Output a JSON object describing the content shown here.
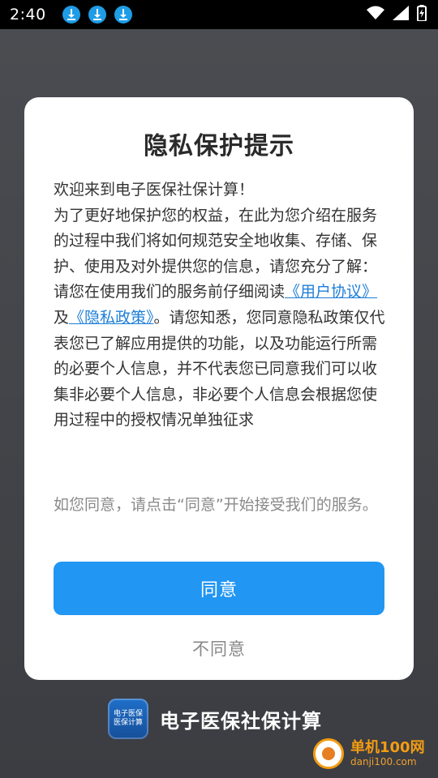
{
  "status_bar": {
    "time": "2:40",
    "download_icons": [
      "download-icon",
      "download-icon",
      "download-icon"
    ],
    "icons": [
      "wifi-icon",
      "signal-icon",
      "battery-icon"
    ]
  },
  "dialog": {
    "title": "隐私保护提示",
    "paragraph1": "欢迎来到电子医保社保计算！",
    "paragraph2": "为了更好地保护您的权益，在此为您介绍在服务的过程中我们将如何规范安全地收集、存储、保护、使用及对外提供您的信息，请您充分了解：",
    "paragraph3_prefix": "请您在使用我们的服务前仔细阅读",
    "link_user_agreement": "《用户协议》",
    "and": "及",
    "link_privacy_policy": "《隐私政策》",
    "paragraph3_suffix": "。请您知悉，您同意隐私政策仅代表您已了解应用提供的功能，以及功能运行所需的必要个人信息，并不代表您已同意我们可以收集非必要个人信息，非必要个人信息会根据您使用过程中的授权情况单独征求",
    "note": "如您同意，请点击“同意”开始接受我们的服务。",
    "agree_label": "同意",
    "disagree_label": "不同意"
  },
  "app": {
    "name": "电子医保社保计算",
    "icon_text_top": "电子医保",
    "icon_text_bottom": "医保计算"
  },
  "watermark": {
    "title": "单机100网",
    "subtitle": "danji100.com"
  },
  "colors": {
    "accent": "#2196f3",
    "link": "#1e7fd8",
    "download_badge": "#1e9ce6",
    "watermark": "#f39c12"
  }
}
